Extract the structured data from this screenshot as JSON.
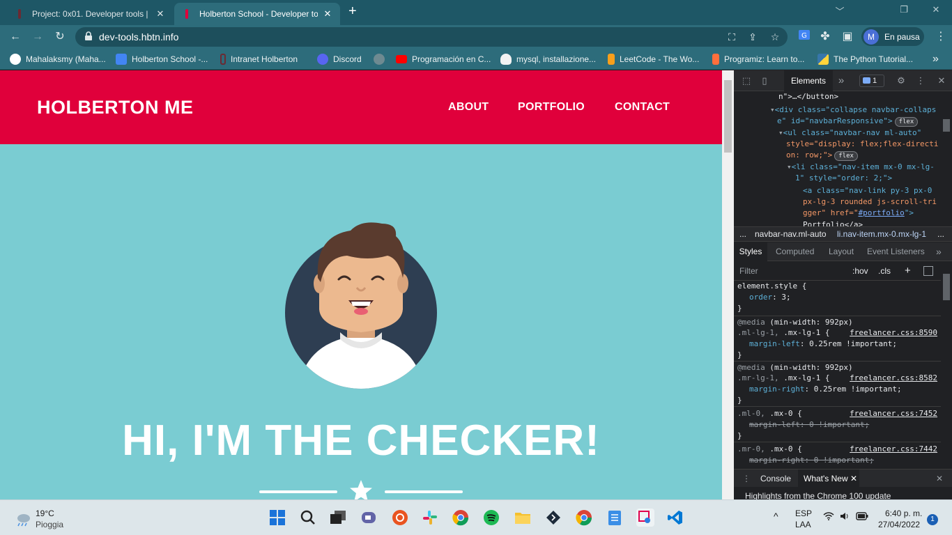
{
  "tabs": [
    {
      "title": "Project: 0x01. Developer tools | H",
      "close": "✕"
    },
    {
      "title": "Holberton School - Developer to",
      "close": "✕"
    }
  ],
  "window_controls": {
    "minimize": "﹀",
    "restore": "❐",
    "close": "✕"
  },
  "address_bar": {
    "url": "dev-tools.hbtn.info"
  },
  "profile": {
    "initial": "M",
    "status": "En pausa"
  },
  "bookmarks": [
    {
      "label": "Mahalaksmy (Maha...",
      "icon": "github-icon",
      "color": "#ffffff"
    },
    {
      "label": "Holberton School -...",
      "icon": "calendar-icon",
      "color": "#4285f4"
    },
    {
      "label": "Intranet Holberton",
      "icon": "holberton-icon",
      "color": "#e0003b"
    },
    {
      "label": "Discord",
      "icon": "discord-icon",
      "color": "#5865f2"
    },
    {
      "label": "Programación en C...",
      "icon": "youtube-icon",
      "color": "#ff0000"
    },
    {
      "label": "mysql, installazione...",
      "icon": "linux-icon",
      "color": "#f2f2f2"
    },
    {
      "label": "LeetCode - The Wo...",
      "icon": "leetcode-icon",
      "color": "#f89f1b"
    },
    {
      "label": "Programiz: Learn to...",
      "icon": "programiz-icon",
      "color": "#ff6f3c"
    },
    {
      "label": "The Python Tutorial...",
      "icon": "python-icon",
      "color": "#3776ab"
    }
  ],
  "bookmarks_more": "»",
  "page": {
    "brand": "HOLBERTON ME",
    "nav": [
      "ABOUT",
      "PORTFOLIO",
      "CONTACT"
    ],
    "heading": "HI, I'M THE CHECKER!",
    "colors": {
      "nav_bg": "#e0003b",
      "hero_bg": "#7accd2"
    }
  },
  "devtools": {
    "elements_tab": "Elements",
    "more_tabs": "»",
    "issues_count": "1",
    "dom": {
      "l1_a": "n\">…</button>",
      "l2_tag": "<div class=\"collapse navbar-collaps",
      "l3_text": "e\" id=\"navbarResponsive\">",
      "l4_tag": "<ul class=\"navbar-nav ml-auto\"",
      "l5_text": "style=\"display: flex;flex-directi",
      "l6_text": "on: row;\">",
      "l7_tag": "<li class=\"nav-item mx-0 mx-lg-",
      "l8_text": "1\" style=\"order: 2;\">",
      "l9_tag": "<a class=\"nav-link py-3 px-0",
      "l10_text": "px-lg-3 rounded js-scroll-tri",
      "l11_text": "gger\" href=\"",
      "l11_link": "#portfolio",
      "l11_end": "\">",
      "l12_text": "Portfolio</a>",
      "badge": "flex"
    },
    "breadcrumbs": {
      "dots": "...",
      "item1": "navbar-nav.ml-auto",
      "item2": "li.nav-item.mx-0.mx-lg-1",
      "more": "..."
    },
    "style_tabs": [
      "Styles",
      "Computed",
      "Layout",
      "Event Listeners"
    ],
    "filter": {
      "placeholder": "Filter",
      "hov": ":hov",
      "cls": ".cls",
      "plus": "+"
    },
    "rules": {
      "r1_sel": "element.style {",
      "r1_prop": "order",
      "r1_val": "3;",
      "close": "}",
      "media": "@media",
      "media_q": "(min-width: 992px)",
      "r2_sel_dim": ".ml-lg-1,",
      "r2_sel": ".mx-lg-1 {",
      "r2_src": "freelancer.css:8590",
      "r2_prop": "margin-left",
      "r2_val": "0.25rem !important;",
      "r3_sel_dim": ".mr-lg-1,",
      "r3_sel": ".mx-lg-1 {",
      "r3_src": "freelancer.css:8582",
      "r3_prop": "margin-right",
      "r3_val": "0.25rem !important;",
      "r4_sel_dim": ".ml-0,",
      "r4_sel": ".mx-0 {",
      "r4_src": "freelancer.css:7452",
      "r4_prop": "margin-left",
      "r4_val": "0 !important;",
      "r5_sel_dim": ".mr-0,",
      "r5_sel": ".mx-0 {",
      "r5_src": "freelancer.css:7442",
      "r5_prop": "margin-right",
      "r5_val": "0 !important;"
    },
    "drawer": {
      "console": "Console",
      "whatsnew": "What's New",
      "close": "✕",
      "highlight": "Highlights from the Chrome 100 update"
    }
  },
  "taskbar": {
    "weather_temp": "19°C",
    "weather_desc": "Pioggia",
    "lang1": "ESP",
    "lang2": "LAA",
    "time": "6:40 p. m.",
    "date": "27/04/2022",
    "notifications": "1",
    "chevron": "^"
  }
}
